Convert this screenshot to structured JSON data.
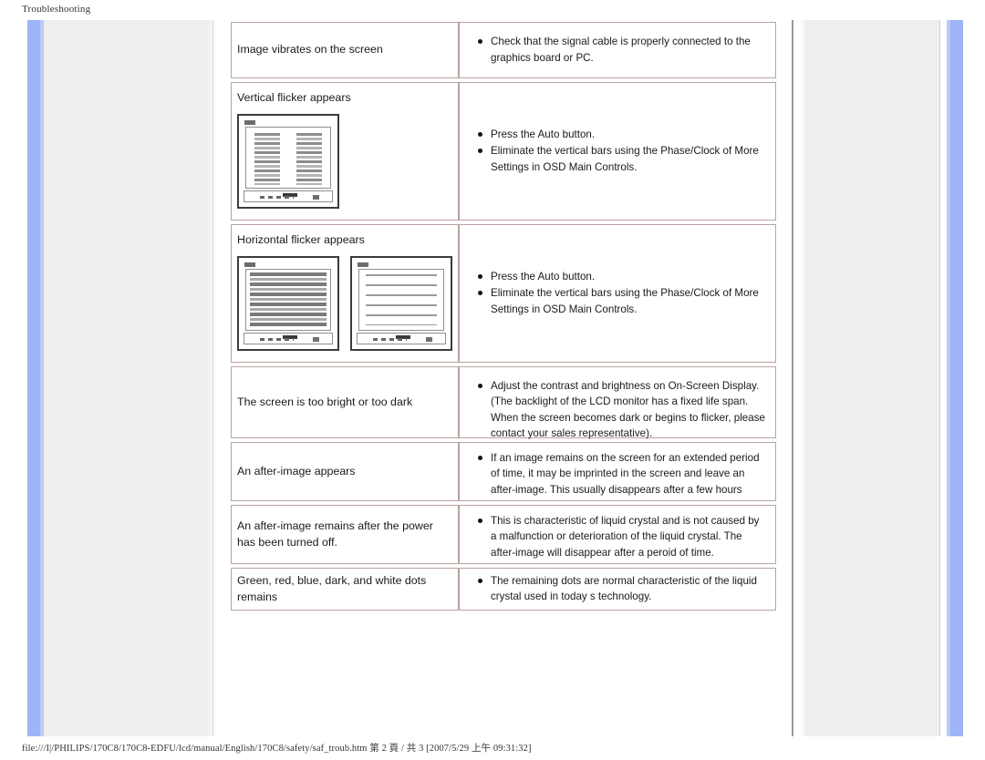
{
  "document": {
    "header_title": "Troubleshooting",
    "footer_path": "file:///I|/PHILIPS/170C8/170C8-EDFU/lcd/manual/English/170C8/safety/saf_troub.htm 第 2 頁 / 共 3 [2007/5/29 上午 09:31:32]"
  },
  "colors": {
    "table_border": "#b9a3a0",
    "accent_blue": "#9db4f7",
    "panel_grey": "#eeeeee",
    "text": "#1a1a1a"
  },
  "table": {
    "rows": [
      {
        "symptom": "Image vibrates on the screen",
        "images": [],
        "solutions": [
          "Check that the signal cable is properly connected to the graphics board or PC."
        ]
      },
      {
        "symptom": "Vertical flicker appears",
        "images": [
          "vertical-bars-monitor"
        ],
        "solutions": [
          "Press the Auto button.",
          "Eliminate the vertical bars using the Phase/Clock of More Settings in OSD Main Controls."
        ]
      },
      {
        "symptom": "Horizontal flicker appears",
        "images": [
          "horizontal-bars-monitor",
          "clean-screen-monitor"
        ],
        "solutions": [
          "Press the Auto button.",
          "Eliminate the vertical bars using the Phase/Clock of More Settings in OSD Main Controls."
        ]
      },
      {
        "symptom": "The screen is too bright or too dark",
        "images": [],
        "solutions": [
          "Adjust the contrast and brightness on On-Screen Display. (The backlight of the LCD monitor has a fixed life span. When the screen becomes dark or begins to flicker, please contact your sales representative)."
        ]
      },
      {
        "symptom": "An after-image appears",
        "images": [],
        "solutions": [
          "If an image remains on the screen for an extended period of time, it may be imprinted in the screen and leave an after-image. This usually disappears after a few hours"
        ]
      },
      {
        "symptom": "An after-image remains after the power has been turned off.",
        "images": [],
        "solutions": [
          "This is characteristic of liquid crystal and is not caused by a malfunction or deterioration of the liquid crystal. The after-image will disappear after a peroid of time."
        ]
      },
      {
        "symptom": "Green, red, blue, dark, and white dots remains",
        "images": [],
        "solutions": [
          "The remaining dots are normal characteristic of the liquid crystal used in today s technology."
        ]
      }
    ]
  }
}
